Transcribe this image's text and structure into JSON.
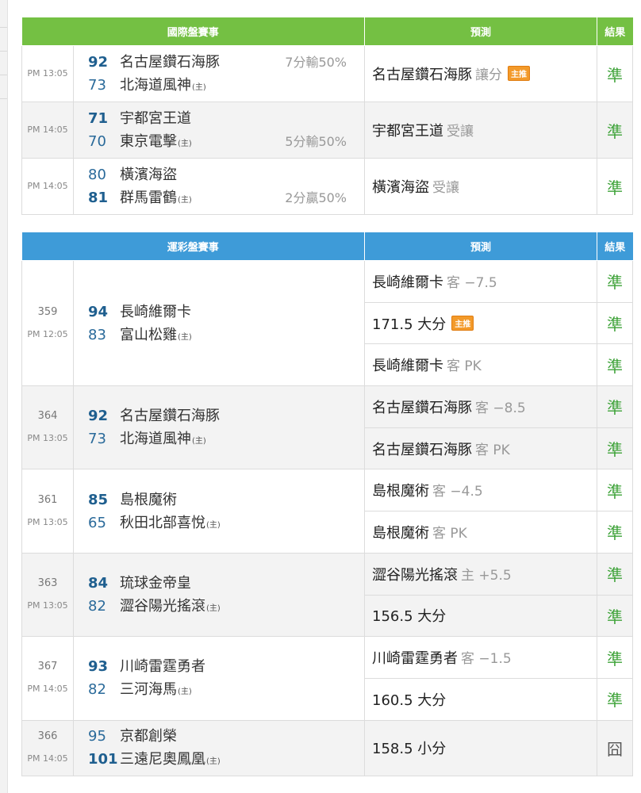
{
  "international": {
    "headers": {
      "match": "國際盤賽事",
      "prediction": "預測",
      "result": "結果"
    },
    "rows": [
      {
        "time": "PM 13:05",
        "away": {
          "score": "92",
          "name": "名古屋鑽石海豚",
          "win": true
        },
        "home": {
          "score": "73",
          "name": "北海道風神",
          "mark": "(主)"
        },
        "handicap": "7分輸50%",
        "handicap_line": "away",
        "pick": "名古屋鑽石海豚",
        "pick_sub": "讓分",
        "badge": "主推",
        "result": "準"
      },
      {
        "time": "PM 14:05",
        "away": {
          "score": "71",
          "name": "宇都宮王道",
          "win": true
        },
        "home": {
          "score": "70",
          "name": "東京電擊",
          "mark": "(主)"
        },
        "handicap": "5分輸50%",
        "handicap_line": "home",
        "pick": "宇都宮王道",
        "pick_sub": "受讓",
        "result": "準"
      },
      {
        "time": "PM 14:05",
        "away": {
          "score": "80",
          "name": "橫濱海盜"
        },
        "home": {
          "score": "81",
          "name": "群馬雷鶴",
          "mark": "(主)",
          "win": true
        },
        "handicap": "2分贏50%",
        "handicap_line": "home",
        "pick": "橫濱海盜",
        "pick_sub": "受讓",
        "result": "準"
      }
    ]
  },
  "lottery": {
    "headers": {
      "match": "運彩盤賽事",
      "prediction": "預測",
      "result": "結果"
    },
    "games": [
      {
        "code": "359",
        "time": "PM 12:05",
        "away": {
          "score": "94",
          "name": "長崎維爾卡",
          "win": true
        },
        "home": {
          "score": "83",
          "name": "富山松雞",
          "mark": "(主)"
        },
        "picks": [
          {
            "main": "長崎維爾卡",
            "sub": "客 −7.5",
            "result": "準"
          },
          {
            "main": "171.5 大分",
            "badge": "主推",
            "result": "準"
          },
          {
            "main": "長崎維爾卡",
            "sub": "客 PK",
            "result": "準"
          }
        ]
      },
      {
        "code": "364",
        "time": "PM 13:05",
        "away": {
          "score": "92",
          "name": "名古屋鑽石海豚",
          "win": true
        },
        "home": {
          "score": "73",
          "name": "北海道風神",
          "mark": "(主)"
        },
        "picks": [
          {
            "main": "名古屋鑽石海豚",
            "sub": "客 −8.5",
            "result": "準"
          },
          {
            "main": "名古屋鑽石海豚",
            "sub": "客 PK",
            "result": "準"
          }
        ]
      },
      {
        "code": "361",
        "time": "PM 13:05",
        "away": {
          "score": "85",
          "name": "島根魔術",
          "win": true
        },
        "home": {
          "score": "65",
          "name": "秋田北部喜悅",
          "mark": "(主)"
        },
        "picks": [
          {
            "main": "島根魔術",
            "sub": "客 −4.5",
            "result": "準"
          },
          {
            "main": "島根魔術",
            "sub": "客 PK",
            "result": "準"
          }
        ]
      },
      {
        "code": "363",
        "time": "PM 13:05",
        "away": {
          "score": "84",
          "name": "琉球金帝皇",
          "win": true
        },
        "home": {
          "score": "82",
          "name": "澀谷陽光搖滾",
          "mark": "(主)"
        },
        "picks": [
          {
            "main": "澀谷陽光搖滾",
            "sub": "主 +5.5",
            "result": "準"
          },
          {
            "main": "156.5 大分",
            "result": "準"
          }
        ]
      },
      {
        "code": "367",
        "time": "PM 14:05",
        "away": {
          "score": "93",
          "name": "川崎雷霆勇者",
          "win": true
        },
        "home": {
          "score": "82",
          "name": "三河海馬",
          "mark": "(主)"
        },
        "picks": [
          {
            "main": "川崎雷霆勇者",
            "sub": "客 −1.5",
            "result": "準"
          },
          {
            "main": "160.5 大分",
            "result": "準"
          }
        ]
      },
      {
        "code": "366",
        "time": "PM 14:05",
        "away": {
          "score": "95",
          "name": "京都創榮"
        },
        "home": {
          "score": "101",
          "name": "三遠尼奧鳳凰",
          "mark": "(主)",
          "win": true
        },
        "picks": [
          {
            "main": "158.5 小分",
            "result": "囧"
          }
        ]
      }
    ]
  }
}
